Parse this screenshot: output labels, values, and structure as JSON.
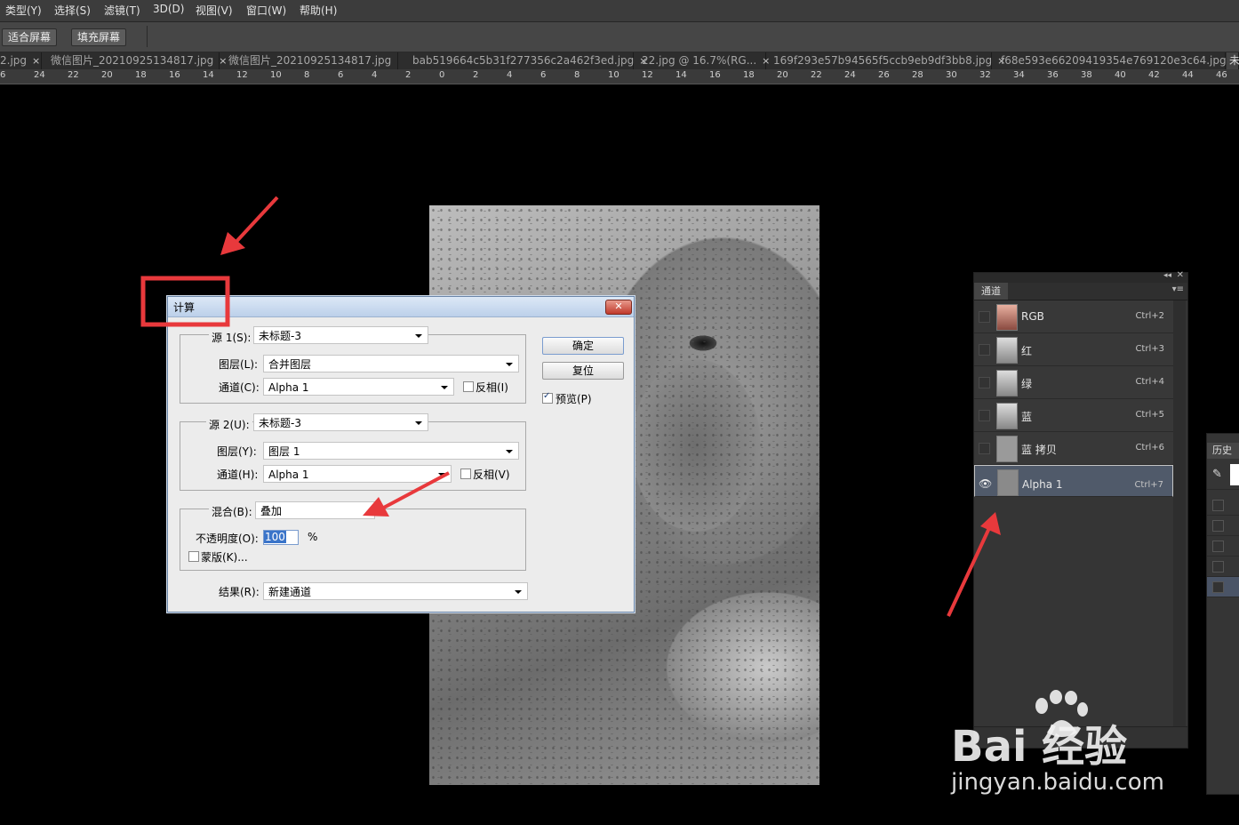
{
  "menubar": {
    "items": [
      "类型(Y)",
      "选择(S)",
      "滤镜(T)",
      "3D(D)",
      "视图(V)",
      "窗口(W)",
      "帮助(H)"
    ]
  },
  "options": {
    "fit_screen": "适合屏幕",
    "fill_screen": "填充屏幕"
  },
  "tabs": [
    "2.jpg",
    "微信图片_20210925134817.jpg",
    "微信图片_20210925134817.jpg",
    "bab519664c5b31f277356c2a462f3ed.jpg",
    "22.jpg @ 16.7%(RG...",
    "169f293e57b94565f5ccb9eb9df3bb8.jpg",
    "f68e593e66209419354e769120e3c64.jpg",
    "未"
  ],
  "ruler": [
    "6",
    "24",
    "22",
    "20",
    "18",
    "16",
    "14",
    "12",
    "10",
    "8",
    "6",
    "4",
    "2",
    "0",
    "2",
    "4",
    "6",
    "8",
    "10",
    "12",
    "14",
    "16",
    "18",
    "20",
    "22",
    "24",
    "26",
    "28",
    "30",
    "32",
    "34",
    "36",
    "38",
    "40",
    "42",
    "44",
    "46"
  ],
  "dialog": {
    "title": "计算",
    "source1": {
      "label": "源 1(S):",
      "value": "未标题-3",
      "layer_label": "图层(L):",
      "layer_value": "合并图层",
      "channel_label": "通道(C):",
      "channel_value": "Alpha 1",
      "invert_label": "反相(I)"
    },
    "source2": {
      "label": "源 2(U):",
      "value": "未标题-3",
      "layer_label": "图层(Y):",
      "layer_value": "图层 1",
      "channel_label": "通道(H):",
      "channel_value": "Alpha 1",
      "invert_label": "反相(V)"
    },
    "blend": {
      "label": "混合(B):",
      "value": "叠加",
      "opacity_label": "不透明度(O):",
      "opacity_value": "100",
      "opacity_unit": "%",
      "mask_label": "蒙版(K)..."
    },
    "result": {
      "label": "结果(R):",
      "value": "新建通道"
    },
    "ok": "确定",
    "reset": "复位",
    "preview": "预览(P)"
  },
  "channels": {
    "tab": "通道",
    "rows": [
      {
        "name": "RGB",
        "key": "Ctrl+2"
      },
      {
        "name": "红",
        "key": "Ctrl+3"
      },
      {
        "name": "绿",
        "key": "Ctrl+4"
      },
      {
        "name": "蓝",
        "key": "Ctrl+5"
      },
      {
        "name": "蓝 拷贝",
        "key": "Ctrl+6"
      },
      {
        "name": "Alpha 1",
        "key": "Ctrl+7"
      }
    ]
  },
  "history": {
    "tab": "历史"
  },
  "watermark": {
    "logo": "Bai 经验",
    "url": "jingyan.baidu.com"
  },
  "colors": {
    "annotation_red": "#e8393c",
    "selected_row": "#505a6a"
  }
}
